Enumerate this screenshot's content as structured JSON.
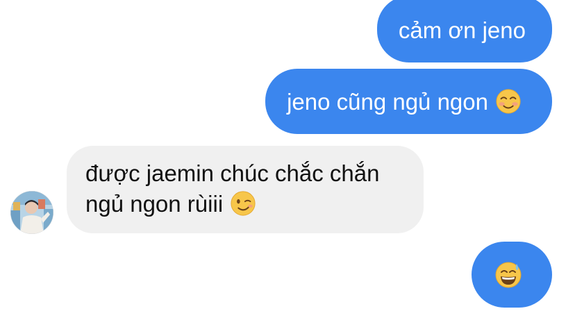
{
  "messages": [
    {
      "sender": "me",
      "text": "cảm ơn jeno",
      "emoji": ""
    },
    {
      "sender": "me",
      "text": "jeno cũng ngủ ngon",
      "emoji": "smiling-blush-emoji"
    },
    {
      "sender": "jaemin",
      "text": "được jaemin chúc chắc chắn ngủ ngon rùiii",
      "emoji": "wink-emoji"
    },
    {
      "sender": "me",
      "text": "",
      "emoji": "grinning-sweat-emoji"
    }
  ],
  "avatar": {
    "icon": "contact-avatar"
  },
  "colors": {
    "outgoing_bubble": "#3b86ee",
    "incoming_bubble": "#f0f0f0",
    "outgoing_text": "#ffffff",
    "incoming_text": "#111111"
  }
}
